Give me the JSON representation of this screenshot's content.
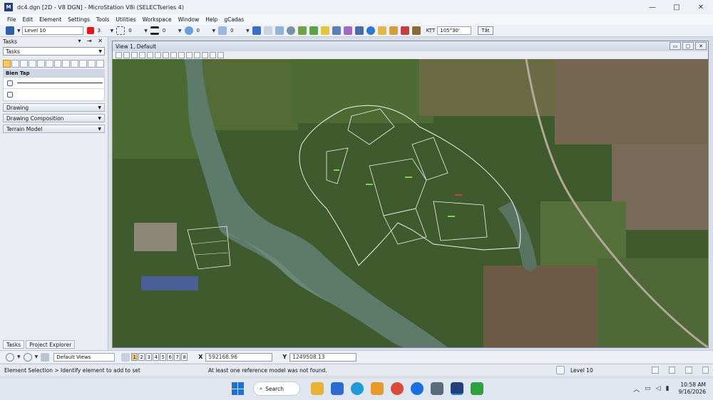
{
  "window": {
    "title": "dc4.dgn [2D - V8 DGN] - MicroStation V8i (SELECTseries 4)",
    "icon_text": "M",
    "controls": [
      "—",
      "□",
      "✕"
    ]
  },
  "menu": [
    "File",
    "Edit",
    "Element",
    "Settings",
    "Tools",
    "Utilities",
    "Workspace",
    "Window",
    "Help",
    "gCadas"
  ],
  "attributes": {
    "level": "Level 10",
    "color": "3",
    "line_style": "0",
    "line_weight": "0",
    "transparency": "0",
    "priority": "0",
    "ktt_label": "KTT",
    "ktt_value": "105°30'",
    "off_button": "Tắt"
  },
  "tasks": {
    "header": "Tasks",
    "selected_task": "Tasks",
    "section": "Bien Tap",
    "groups": [
      "Drawing",
      "Drawing Composition",
      "Terrain Model"
    ],
    "tabs": [
      "Tasks",
      "Project Explorer"
    ]
  },
  "view": {
    "title": "View 1, Default",
    "view_buttons": [
      "▭",
      "▢",
      "✕"
    ]
  },
  "viewbar": {
    "saved_view": "Default Views",
    "view_numbers": [
      "1",
      "2",
      "3",
      "4",
      "5",
      "6",
      "7",
      "8"
    ],
    "active_view": "1",
    "x_label": "X",
    "x_value": "592168.96",
    "y_label": "Y",
    "y_value": "1249508.13"
  },
  "status": {
    "prompt": "Element Selection > Identify element to add to set",
    "message": "At least one reference model was not found.",
    "level": "Level 10"
  },
  "taskbar": {
    "search_label": "Search",
    "time": "10:58 AM",
    "date": "9/16/2026"
  }
}
